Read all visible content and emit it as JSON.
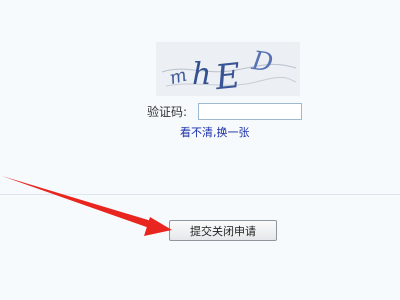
{
  "captcha": {
    "image_text": "mhED",
    "label": "验证码:",
    "input_value": "",
    "refresh_link": "看不清,换一张",
    "link_color": "#1b2fa8"
  },
  "form": {
    "submit_label": "提交关闭申请"
  },
  "annotation": {
    "arrow_color": "#e8251f",
    "arrow_target": "submit-button"
  }
}
